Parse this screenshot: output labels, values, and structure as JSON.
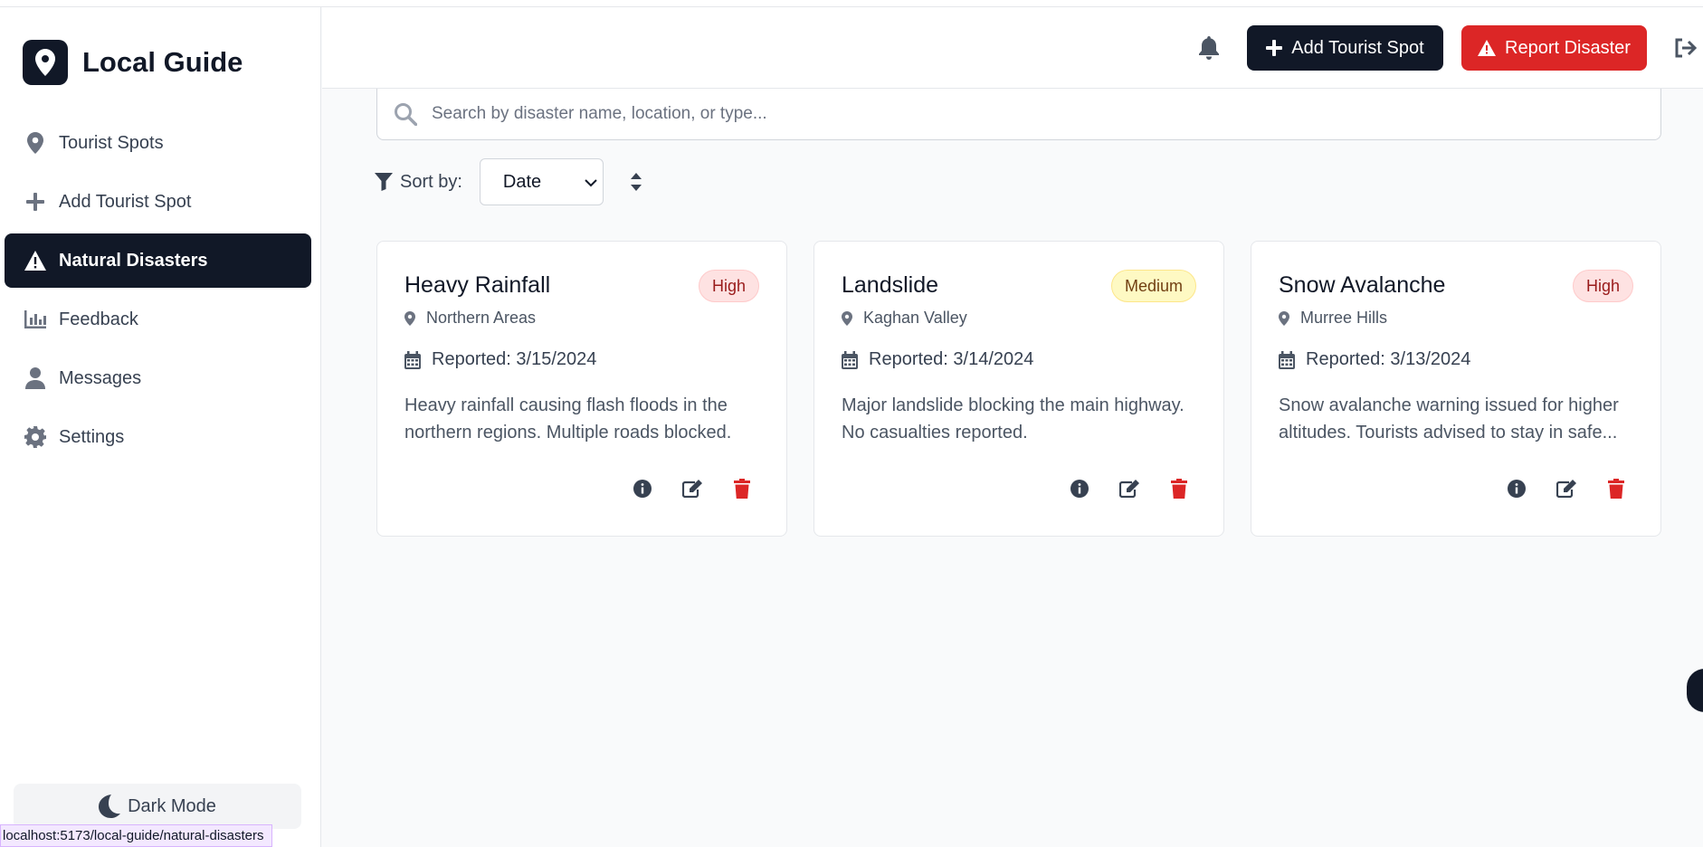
{
  "app": {
    "title": "Local Guide"
  },
  "sidebar": {
    "items": [
      {
        "label": "Tourist Spots",
        "icon": "map-pin-icon"
      },
      {
        "label": "Add Tourist Spot",
        "icon": "plus-icon"
      },
      {
        "label": "Natural Disasters",
        "icon": "warning-icon",
        "active": true
      },
      {
        "label": "Feedback",
        "icon": "chart-bar-icon"
      },
      {
        "label": "Messages",
        "icon": "user-icon"
      },
      {
        "label": "Settings",
        "icon": "gear-icon"
      }
    ],
    "dark_mode_label": "Dark Mode"
  },
  "header": {
    "add_spot_label": "Add Tourist Spot",
    "report_disaster_label": "Report Disaster"
  },
  "search": {
    "placeholder": "Search by disaster name, location, or type...",
    "value": ""
  },
  "sort": {
    "label": "Sort by:",
    "selected": "Date"
  },
  "disasters": [
    {
      "title": "Heavy Rainfall",
      "severity": "High",
      "location": "Northern Areas",
      "reported": "Reported: 3/15/2024",
      "description": "Heavy rainfall causing flash floods in the northern regions. Multiple roads blocked."
    },
    {
      "title": "Landslide",
      "severity": "Medium",
      "location": "Kaghan Valley",
      "reported": "Reported: 3/14/2024",
      "description": "Major landslide blocking the main highway. No casualties reported."
    },
    {
      "title": "Snow Avalanche",
      "severity": "High",
      "location": "Murree Hills",
      "reported": "Reported: 3/13/2024",
      "description": "Snow avalanche warning issued for higher altitudes. Tourists advised to stay in safe..."
    }
  ],
  "status_bar": {
    "url": "localhost:5173/local-guide/natural-disasters"
  },
  "colors": {
    "primary": "#111827",
    "danger": "#dc2626",
    "high_badge_bg": "#fee2e2",
    "medium_badge_bg": "#fef9c3"
  }
}
